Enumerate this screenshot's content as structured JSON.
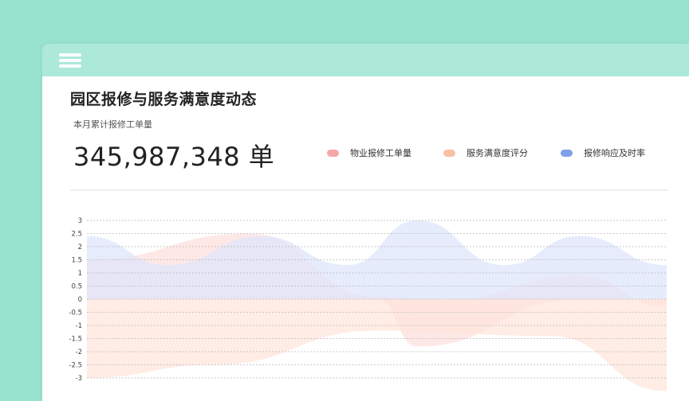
{
  "header": {
    "menu_icon": "hamburger-menu-icon",
    "background": "#ace9d9"
  },
  "dashboard": {
    "title": "园区报修与服务满意度动态",
    "subtitle": "本月累计报修工单量",
    "total_value": "345,987,348",
    "total_unit": "单"
  },
  "legend": [
    {
      "label": "物业报修工单量",
      "color": "#f7a7a7"
    },
    {
      "label": "服务满意度评分",
      "color": "#f9c0a2"
    },
    {
      "label": "报修响应及时率",
      "color": "#7f9fea"
    }
  ],
  "chart_data": {
    "type": "area",
    "ylim": [
      -3,
      3
    ],
    "y_ticks": [
      "3",
      "2.5",
      "2",
      "1.5",
      "1",
      "0.5",
      "0",
      "-0.5",
      "-1",
      "-1.5",
      "-2",
      "-2.5",
      "-3"
    ],
    "grid": true,
    "legend_placement": "top-right",
    "x": [
      0,
      0.25,
      0.5,
      0.75,
      1
    ],
    "series": [
      {
        "name": "物业报修工单量",
        "color": "#fde0de",
        "upper": [
          1.5,
          2.5,
          0.1,
          0.0,
          0.9,
          -0.3
        ],
        "lower": [
          0.0,
          0.0,
          0.0,
          -1.8,
          0.0,
          0.0
        ],
        "upper_x": [
          0,
          0.28,
          0.5,
          0.62,
          0.85,
          1
        ],
        "lower_x": [
          0,
          0.28,
          0.5,
          0.57,
          0.85,
          1
        ]
      },
      {
        "name": "服务满意度评分",
        "color": "#fde6dc",
        "upper": [
          0.0,
          0.0,
          0.0,
          0.0,
          0.0
        ],
        "lower": [
          -3.0,
          -2.5,
          -1.2,
          -1.4,
          -3.5
        ],
        "upper_x": [
          0,
          0.25,
          0.5,
          0.75,
          1
        ],
        "lower_x": [
          0,
          0.22,
          0.5,
          0.8,
          1
        ]
      },
      {
        "name": "报修响应及时率",
        "color": "#dfe6fb",
        "upper": [
          2.4,
          1.3,
          2.4,
          1.3,
          3.0,
          1.3,
          2.4,
          1.3
        ],
        "lower": [
          0.0,
          0.0,
          0.0,
          0.0,
          0.0,
          0.0,
          0.0,
          0.0
        ],
        "upper_x": [
          0,
          0.14,
          0.3,
          0.45,
          0.57,
          0.72,
          0.85,
          1
        ],
        "lower_x": [
          0,
          0.14,
          0.3,
          0.45,
          0.57,
          0.72,
          0.85,
          1
        ]
      }
    ]
  }
}
